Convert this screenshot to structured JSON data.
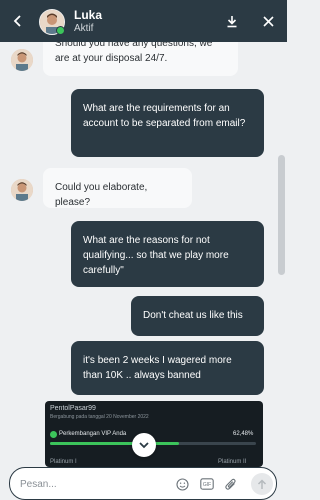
{
  "header": {
    "agent_name": "Luka",
    "agent_status": "Aktif",
    "back_icon": "back-arrow-icon",
    "download_icon": "download-icon",
    "close_icon": "close-icon"
  },
  "messages": [
    {
      "from": "agent",
      "text": "Should you have any questions, we are at your disposal 24/7."
    },
    {
      "from": "user",
      "text": "What are the requirements for an account to be separated from email?"
    },
    {
      "from": "agent",
      "text": "Could you elaborate, please?"
    },
    {
      "from": "user",
      "text": "What are the reasons for not qualifying... so that we play more carefully\""
    },
    {
      "from": "user",
      "text": "Don't cheat us like this"
    },
    {
      "from": "user",
      "text": "it's been 2 weeks I wagered more than 10K .. always banned"
    }
  ],
  "promo_card": {
    "username": "PentolPasar99",
    "joined": "Bergabung pada tanggal 20 November 2022",
    "vip_label": "Perkembangan VIP Anda",
    "vip_percent": "62,48%",
    "vip_progress": 0.6248,
    "tier_left": "Platinum I",
    "tier_right": "Platinum II"
  },
  "input": {
    "placeholder": "Pesan..."
  },
  "colors": {
    "header_bg": "#2b3a44",
    "user_bubble": "#2b3a44",
    "agent_bubble": "#f8f9fa",
    "online": "#3cc45b"
  }
}
